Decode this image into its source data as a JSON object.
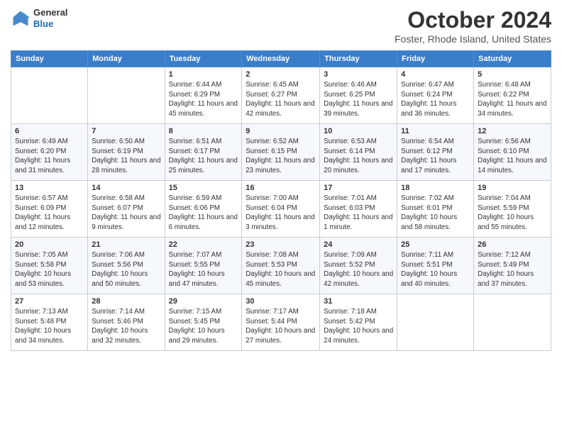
{
  "header": {
    "logo_line1": "General",
    "logo_line2": "Blue",
    "title": "October 2024",
    "subtitle": "Foster, Rhode Island, United States"
  },
  "days_of_week": [
    "Sunday",
    "Monday",
    "Tuesday",
    "Wednesday",
    "Thursday",
    "Friday",
    "Saturday"
  ],
  "weeks": [
    [
      {
        "day": "",
        "text": ""
      },
      {
        "day": "",
        "text": ""
      },
      {
        "day": "1",
        "text": "Sunrise: 6:44 AM\nSunset: 6:29 PM\nDaylight: 11 hours and 45 minutes."
      },
      {
        "day": "2",
        "text": "Sunrise: 6:45 AM\nSunset: 6:27 PM\nDaylight: 11 hours and 42 minutes."
      },
      {
        "day": "3",
        "text": "Sunrise: 6:46 AM\nSunset: 6:25 PM\nDaylight: 11 hours and 39 minutes."
      },
      {
        "day": "4",
        "text": "Sunrise: 6:47 AM\nSunset: 6:24 PM\nDaylight: 11 hours and 36 minutes."
      },
      {
        "day": "5",
        "text": "Sunrise: 6:48 AM\nSunset: 6:22 PM\nDaylight: 11 hours and 34 minutes."
      }
    ],
    [
      {
        "day": "6",
        "text": "Sunrise: 6:49 AM\nSunset: 6:20 PM\nDaylight: 11 hours and 31 minutes."
      },
      {
        "day": "7",
        "text": "Sunrise: 6:50 AM\nSunset: 6:19 PM\nDaylight: 11 hours and 28 minutes."
      },
      {
        "day": "8",
        "text": "Sunrise: 6:51 AM\nSunset: 6:17 PM\nDaylight: 11 hours and 25 minutes."
      },
      {
        "day": "9",
        "text": "Sunrise: 6:52 AM\nSunset: 6:15 PM\nDaylight: 11 hours and 23 minutes."
      },
      {
        "day": "10",
        "text": "Sunrise: 6:53 AM\nSunset: 6:14 PM\nDaylight: 11 hours and 20 minutes."
      },
      {
        "day": "11",
        "text": "Sunrise: 6:54 AM\nSunset: 6:12 PM\nDaylight: 11 hours and 17 minutes."
      },
      {
        "day": "12",
        "text": "Sunrise: 6:56 AM\nSunset: 6:10 PM\nDaylight: 11 hours and 14 minutes."
      }
    ],
    [
      {
        "day": "13",
        "text": "Sunrise: 6:57 AM\nSunset: 6:09 PM\nDaylight: 11 hours and 12 minutes."
      },
      {
        "day": "14",
        "text": "Sunrise: 6:58 AM\nSunset: 6:07 PM\nDaylight: 11 hours and 9 minutes."
      },
      {
        "day": "15",
        "text": "Sunrise: 6:59 AM\nSunset: 6:06 PM\nDaylight: 11 hours and 6 minutes."
      },
      {
        "day": "16",
        "text": "Sunrise: 7:00 AM\nSunset: 6:04 PM\nDaylight: 11 hours and 3 minutes."
      },
      {
        "day": "17",
        "text": "Sunrise: 7:01 AM\nSunset: 6:03 PM\nDaylight: 11 hours and 1 minute."
      },
      {
        "day": "18",
        "text": "Sunrise: 7:02 AM\nSunset: 6:01 PM\nDaylight: 10 hours and 58 minutes."
      },
      {
        "day": "19",
        "text": "Sunrise: 7:04 AM\nSunset: 5:59 PM\nDaylight: 10 hours and 55 minutes."
      }
    ],
    [
      {
        "day": "20",
        "text": "Sunrise: 7:05 AM\nSunset: 5:58 PM\nDaylight: 10 hours and 53 minutes."
      },
      {
        "day": "21",
        "text": "Sunrise: 7:06 AM\nSunset: 5:56 PM\nDaylight: 10 hours and 50 minutes."
      },
      {
        "day": "22",
        "text": "Sunrise: 7:07 AM\nSunset: 5:55 PM\nDaylight: 10 hours and 47 minutes."
      },
      {
        "day": "23",
        "text": "Sunrise: 7:08 AM\nSunset: 5:53 PM\nDaylight: 10 hours and 45 minutes."
      },
      {
        "day": "24",
        "text": "Sunrise: 7:09 AM\nSunset: 5:52 PM\nDaylight: 10 hours and 42 minutes."
      },
      {
        "day": "25",
        "text": "Sunrise: 7:11 AM\nSunset: 5:51 PM\nDaylight: 10 hours and 40 minutes."
      },
      {
        "day": "26",
        "text": "Sunrise: 7:12 AM\nSunset: 5:49 PM\nDaylight: 10 hours and 37 minutes."
      }
    ],
    [
      {
        "day": "27",
        "text": "Sunrise: 7:13 AM\nSunset: 5:48 PM\nDaylight: 10 hours and 34 minutes."
      },
      {
        "day": "28",
        "text": "Sunrise: 7:14 AM\nSunset: 5:46 PM\nDaylight: 10 hours and 32 minutes."
      },
      {
        "day": "29",
        "text": "Sunrise: 7:15 AM\nSunset: 5:45 PM\nDaylight: 10 hours and 29 minutes."
      },
      {
        "day": "30",
        "text": "Sunrise: 7:17 AM\nSunset: 5:44 PM\nDaylight: 10 hours and 27 minutes."
      },
      {
        "day": "31",
        "text": "Sunrise: 7:18 AM\nSunset: 5:42 PM\nDaylight: 10 hours and 24 minutes."
      },
      {
        "day": "",
        "text": ""
      },
      {
        "day": "",
        "text": ""
      }
    ]
  ]
}
